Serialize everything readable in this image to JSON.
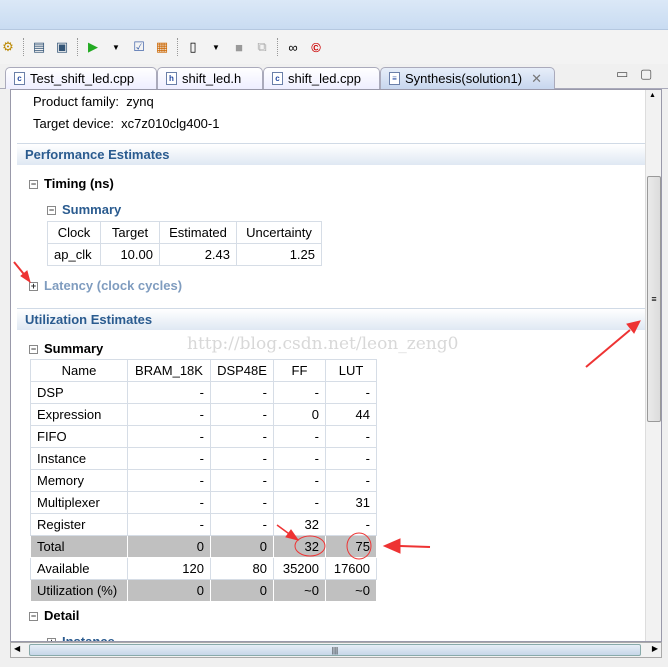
{
  "tabs": [
    {
      "label": "Test_shift_led.cpp",
      "icon": "c"
    },
    {
      "label": "shift_led.h",
      "icon": "h"
    },
    {
      "label": "shift_led.cpp",
      "icon": "c"
    },
    {
      "label": "Synthesis(solution1)",
      "icon": "report"
    }
  ],
  "info": {
    "family_label": "Product family:",
    "family": "zynq",
    "device_label": "Target device:",
    "device": "xc7z010clg400-1"
  },
  "performance": {
    "title": "Performance Estimates",
    "timing": "Timing (ns)",
    "summary": "Summary",
    "headers": [
      "Clock",
      "Target",
      "Estimated",
      "Uncertainty"
    ],
    "row": [
      "ap_clk",
      "10.00",
      "2.43",
      "1.25"
    ],
    "latency": "Latency (clock cycles)"
  },
  "utilization": {
    "title": "Utilization Estimates",
    "summary": "Summary",
    "headers": [
      "Name",
      "BRAM_18K",
      "DSP48E",
      "FF",
      "LUT"
    ],
    "rows": [
      [
        "DSP",
        "-",
        "-",
        "-",
        "-"
      ],
      [
        "Expression",
        "-",
        "-",
        "0",
        "44"
      ],
      [
        "FIFO",
        "-",
        "-",
        "-",
        "-"
      ],
      [
        "Instance",
        "-",
        "-",
        "-",
        "-"
      ],
      [
        "Memory",
        "-",
        "-",
        "-",
        "-"
      ],
      [
        "Multiplexer",
        "-",
        "-",
        "-",
        "31"
      ],
      [
        "Register",
        "-",
        "-",
        "32",
        "-"
      ],
      [
        "Total",
        "0",
        "0",
        "32",
        "75"
      ],
      [
        "Available",
        "120",
        "80",
        "35200",
        "17600"
      ],
      [
        "Utilization (%)",
        "0",
        "0",
        "~0",
        "~0"
      ]
    ],
    "detail": "Detail",
    "instance": "Instance"
  },
  "watermark": "http://blog.csdn.net/leon_zeng0",
  "annotation_color": "#ee3333"
}
